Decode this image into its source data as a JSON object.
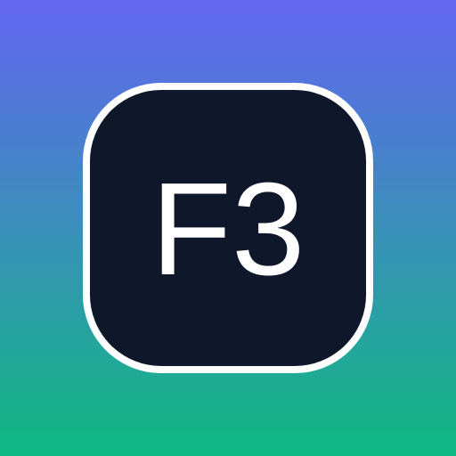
{
  "key": {
    "label": "F3"
  },
  "colors": {
    "background_top": "#6366f1",
    "background_bottom": "#10b981",
    "key_fill": "#0f172a",
    "key_border": "#ffffff",
    "label_text": "#ffffff"
  }
}
